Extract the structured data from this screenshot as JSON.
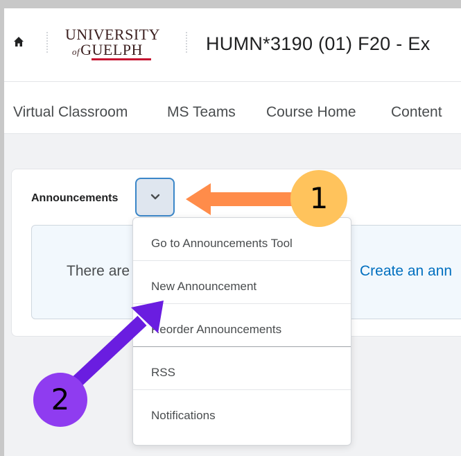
{
  "header": {
    "logo": {
      "line1": "UNIVERSITY",
      "line2_prefix": "of",
      "line2": "GUELPH"
    },
    "course_title": "HUMN*3190 (01) F20 - Ex",
    "home_icon": "home-icon"
  },
  "nav": {
    "items": [
      {
        "label": "Virtual Classroom"
      },
      {
        "label": "MS Teams"
      },
      {
        "label": "Course Home"
      },
      {
        "label": "Content"
      }
    ]
  },
  "announcements": {
    "title": "Announcements",
    "dropdown_icon": "chevron-down-icon",
    "empty_text": "There are",
    "create_link": "Create an ann"
  },
  "menu": {
    "items": [
      {
        "label": "Go to Announcements Tool"
      },
      {
        "label": "New Announcement"
      },
      {
        "label": "Reorder Announcements"
      },
      {
        "label": "RSS"
      },
      {
        "label": "Notifications"
      }
    ]
  },
  "annotations": {
    "step1": "1",
    "step2": "2",
    "colors": {
      "step1": "#ffc35c",
      "arrow1": "#ff8c4a",
      "step2": "#8f3cf0",
      "arrow2": "#6a1de0"
    }
  }
}
